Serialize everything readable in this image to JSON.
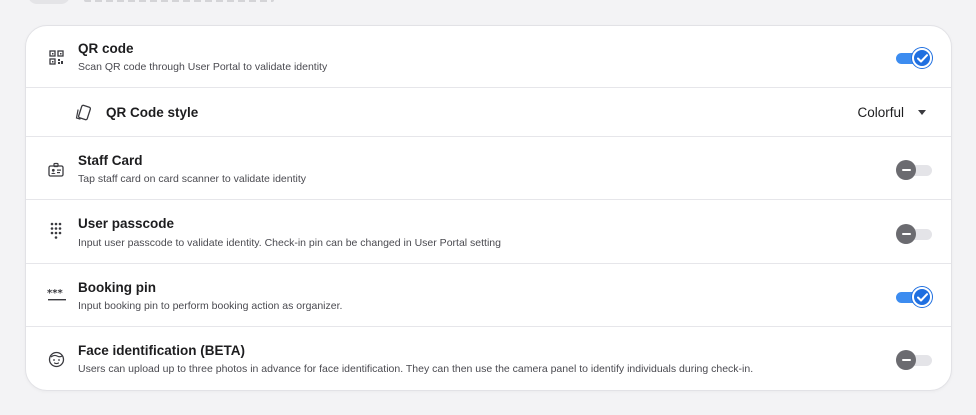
{
  "settings": [
    {
      "id": "qr",
      "title": "QR code",
      "description": "Scan QR code through User Portal to validate identity",
      "icon": "qr-code-icon",
      "enabled": true
    },
    {
      "id": "staff_card",
      "title": "Staff Card",
      "description": "Tap staff card on card scanner to validate identity",
      "icon": "id-card-icon",
      "enabled": false
    },
    {
      "id": "user_passcode",
      "title": "User passcode",
      "description": "Input user passcode to validate identity. Check-in pin can be changed in User Portal setting",
      "icon": "keypad-icon",
      "enabled": false
    },
    {
      "id": "booking_pin",
      "title": "Booking pin",
      "description": "Input booking pin to perform booking action as organizer.",
      "icon": "password-dots-icon",
      "enabled": true
    },
    {
      "id": "face_identification",
      "title": "Face identification (BETA)",
      "description": "Users can upload up to three photos in advance for face identification. They can then use the camera panel to identify individuals during check-in.",
      "icon": "face-icon",
      "enabled": false
    }
  ],
  "qr_style": {
    "label": "QR Code style",
    "value": "Colorful",
    "icon": "cards-icon"
  },
  "colors": {
    "toggle_on": "#1f6fe0",
    "toggle_on_track": "#3c8cf0",
    "toggle_off_knob": "#6b6b70",
    "toggle_off_track": "#e4e4e8"
  }
}
